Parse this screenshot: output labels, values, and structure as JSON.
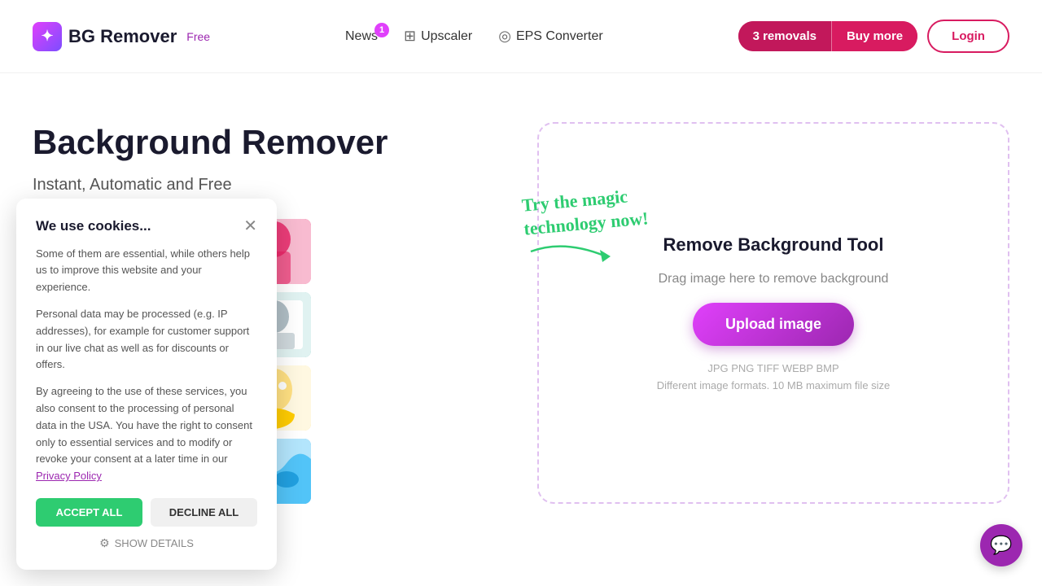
{
  "header": {
    "logo_text": "BG Remover",
    "logo_free": "Free",
    "logo_icon": "✦",
    "nav": [
      {
        "id": "news",
        "label": "News",
        "badge": "1"
      },
      {
        "id": "upscaler",
        "label": "Upscaler",
        "icon": "⊞"
      },
      {
        "id": "eps",
        "label": "EPS Converter",
        "icon": "◎"
      }
    ],
    "removals_count": "3 removals",
    "buy_more": "Buy more",
    "login": "Login"
  },
  "hero": {
    "title": "Background Remover",
    "subtitle": "Instant, Automatic and Free"
  },
  "upload_tool": {
    "title": "Remove Background Tool",
    "drag_text": "Drag image here to remove background",
    "upload_btn": "Upload image",
    "magic_line1": "Try the magic",
    "magic_line2": "technology now!",
    "formats": "JPG PNG TIFF WEBP BMP",
    "size_limit": "Different image formats. 10 MB maximum file size"
  },
  "cookie": {
    "title": "We use cookies...",
    "text1": "Some of them are essential, while others help us to improve this website and your experience.",
    "text2": "Personal data may be processed (e.g. IP addresses), for example for customer support in our live chat as well as for discounts or offers.",
    "text3": "By agreeing to the use of these services, you also consent to the processing of personal data in the USA. You have the right to consent only to essential services and to modify or revoke your consent at a later time in our",
    "privacy_link": "Privacy Policy",
    "accept": "ACCEPT ALL",
    "decline": "DECLINE ALL",
    "show_details": "SHOW DETAILS"
  }
}
